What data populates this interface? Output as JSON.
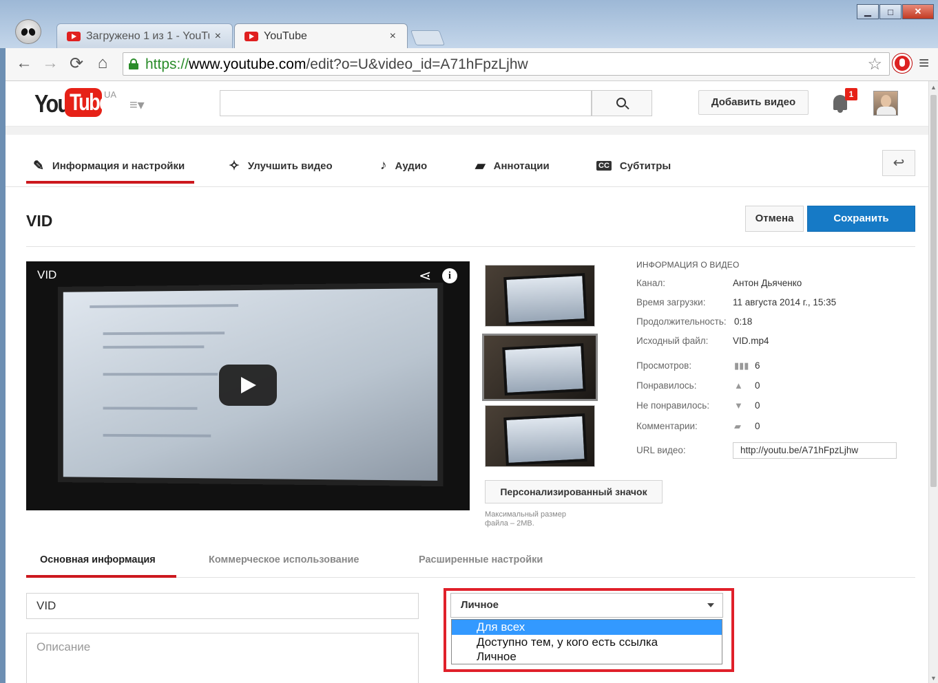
{
  "browser": {
    "tabs": [
      {
        "label": "Загружено 1 из 1 - YouTu",
        "close": "×"
      },
      {
        "label": "YouTube",
        "close": "×"
      }
    ],
    "window_buttons": {
      "minimize": "▁",
      "maximize": "□",
      "close": "✕"
    },
    "address": {
      "scheme": "https://",
      "domain": "www.youtube.com",
      "path": "/edit?o=U&video_id=A71hFpzLjhw"
    },
    "nav": {
      "back": "←",
      "forward": "→",
      "reload": "⟳",
      "home": "⌂"
    },
    "star": "☆",
    "menu": "≡"
  },
  "masthead": {
    "logo_you": "You",
    "logo_tube": "Tube",
    "region": "UA",
    "guide": "≡▾",
    "upload_label": "Добавить видео",
    "notification_count": "1"
  },
  "editor_tabs": [
    {
      "icon": "✎",
      "label": "Информация и настройки"
    },
    {
      "icon": "✧",
      "label": "Улучшить видео"
    },
    {
      "icon": "♪",
      "label": "Аудио"
    },
    {
      "icon": "▰",
      "label": "Аннотации"
    },
    {
      "icon": "CC",
      "label": "Субтитры"
    }
  ],
  "back_icon": "↩",
  "video": {
    "title": "VID",
    "player_title": "VID",
    "share_icon": "⋖",
    "info_icon": "i"
  },
  "actions": {
    "cancel": "Отмена",
    "save": "Сохранить"
  },
  "thumbnails": {
    "custom_label": "Персонализированный значок",
    "note": "Максимальный размер файла – 2MB."
  },
  "info": {
    "heading": "ИНФОРМАЦИЯ О ВИДЕО",
    "channel_label": "Канал:",
    "channel": "Антон Дьяченко",
    "upload_time_label": "Время загрузки:",
    "upload_time": "11 августа 2014 г., 15:35",
    "duration_label": "Продолжительность:",
    "duration": "0:18",
    "source_label": "Исходный файл:",
    "source": "VID.mp4",
    "views_label": "Просмотров:",
    "views": "6",
    "likes_label": "Понравилось:",
    "likes": "0",
    "dislikes_label": "Не понравилось:",
    "dislikes": "0",
    "comments_label": "Комментарии:",
    "comments": "0",
    "url_label": "URL видео:",
    "url": "http://youtu.be/A71hFpzLjhw"
  },
  "sub_tabs": [
    "Основная информация",
    "Коммерческое использование",
    "Расширенные настройки"
  ],
  "form": {
    "title_value": "VID",
    "description_placeholder": "Описание",
    "privacy_selected": "Личное",
    "privacy_options": [
      "Для всех",
      "Доступно тем, у кого есть ссылка",
      "Личное"
    ]
  }
}
